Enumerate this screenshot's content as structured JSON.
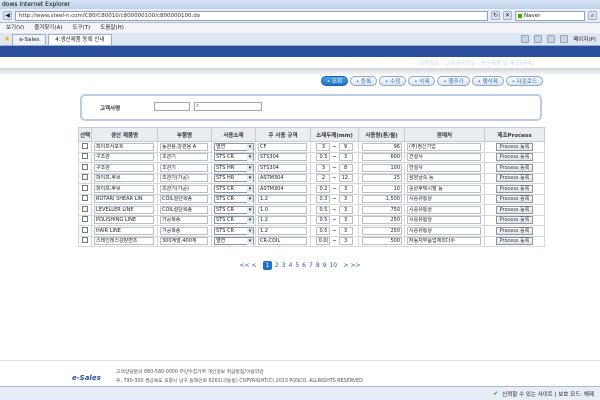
{
  "browser": {
    "window_title": "dows Internet Explorer",
    "url": "http://www.steel-n.com/C80/C80010/c800000100/c800000100.do",
    "search_placeholder": "Naver",
    "menu": [
      "보기(V)",
      "즐겨찾기(A)",
      "도구(T)",
      "도움말(H)"
    ],
    "tabs": [
      "e-Sales",
      "4.생산제품 등록 안내"
    ],
    "page_menu": "페이지(P)"
  },
  "header": {
    "title": "고객사용재품정보 - 생산제품 및 재조(관례)",
    "breadcrumb": "› 고객정보  › 고객관리정보  › 생산제품 및 재조(관례)"
  },
  "actions": [
    "• 조회",
    "• 등록",
    "• 수정",
    "• 삭제",
    "• 행추가",
    "• 행삭제",
    "• 다운로드"
  ],
  "search": {
    "label": "고객사명"
  },
  "table": {
    "columns": [
      "선택",
      "생산 제품명",
      "부품명",
      "사용소재",
      "주 사용 규격",
      "소재두께(mm)",
      "사용량(톤/월)",
      "판매처",
      "제조Process"
    ],
    "rows": [
      [
        "파이프서포트",
        "동관용,강관용 A",
        "열연",
        "CF",
        "3",
        "9",
        "96",
        "(주)정신기업",
        "Process 등록"
      ],
      [
        "구조관",
        "조관기",
        "STS CR",
        "STS304",
        "0.5",
        "3",
        "600",
        "건설사",
        "Process 등록"
      ],
      [
        "구조관",
        "조관기",
        "STS HR",
        "STS304",
        "3",
        "8",
        "100",
        "건설사",
        "Process 등록"
      ],
      [
        "파이프,후브",
        "조관기(가공)",
        "STS HR",
        "ASTM304",
        "2",
        "12.",
        "15",
        "삼양금속 등",
        "Process 등록"
      ],
      [
        "파이프,후브",
        "조관기(가공)",
        "STS CR",
        "ASTM304",
        "0.2",
        "3",
        "10",
        "중원후택시행 등",
        "Process 등록"
      ],
      [
        "ROTARI SHEAR LIN",
        "COIL절단복종",
        "STS CR",
        "1.2",
        "0.3",
        "3",
        "1,500",
        "시중유통상",
        "Process 등록"
      ],
      [
        "LEVELLER LINE",
        "COIL절단복종",
        "STS CR",
        "1.0",
        "0.5",
        "3",
        "750",
        "시중유통상",
        "Process 등록"
      ],
      [
        "POLISHING LINE",
        "가공복종",
        "STS CR",
        "1.2",
        "0.5",
        "3",
        "250",
        "시중유통상",
        "Process 등록"
      ],
      [
        "HAIR LINE",
        "가공복종",
        "STS CR",
        "1.2",
        "0.5",
        "3",
        "250",
        "시중유통상",
        "Process 등록"
      ],
      [
        "스테인레스강판면조",
        "300계열,400계",
        "열연",
        "CR-COIL",
        "0.0(",
        "3",
        "500",
        "자동차부품업체외다수",
        "Process 등록"
      ]
    ]
  },
  "pagination": {
    "prev": "<<  <",
    "pages": [
      "1",
      "2",
      "3",
      "4",
      "5",
      "6",
      "7",
      "8",
      "9",
      "10"
    ],
    "current": "1",
    "next": ">  >>"
  },
  "footer": {
    "logo": "e-Sales",
    "line1": "고객상담문의 080-580-0000    무단수집거부    개인정보 취급방침/이용약관",
    "line2": "우. 790-300 경상북도 포항시 남구 동해안로 6261(괴동동)  COPYRIGHT(C) 2013 POSCO. ALLRIGHTS RESERVED"
  },
  "status": {
    "trusted": "신뢰할 수 있는 사이트 | 보호 모드: 해제"
  }
}
